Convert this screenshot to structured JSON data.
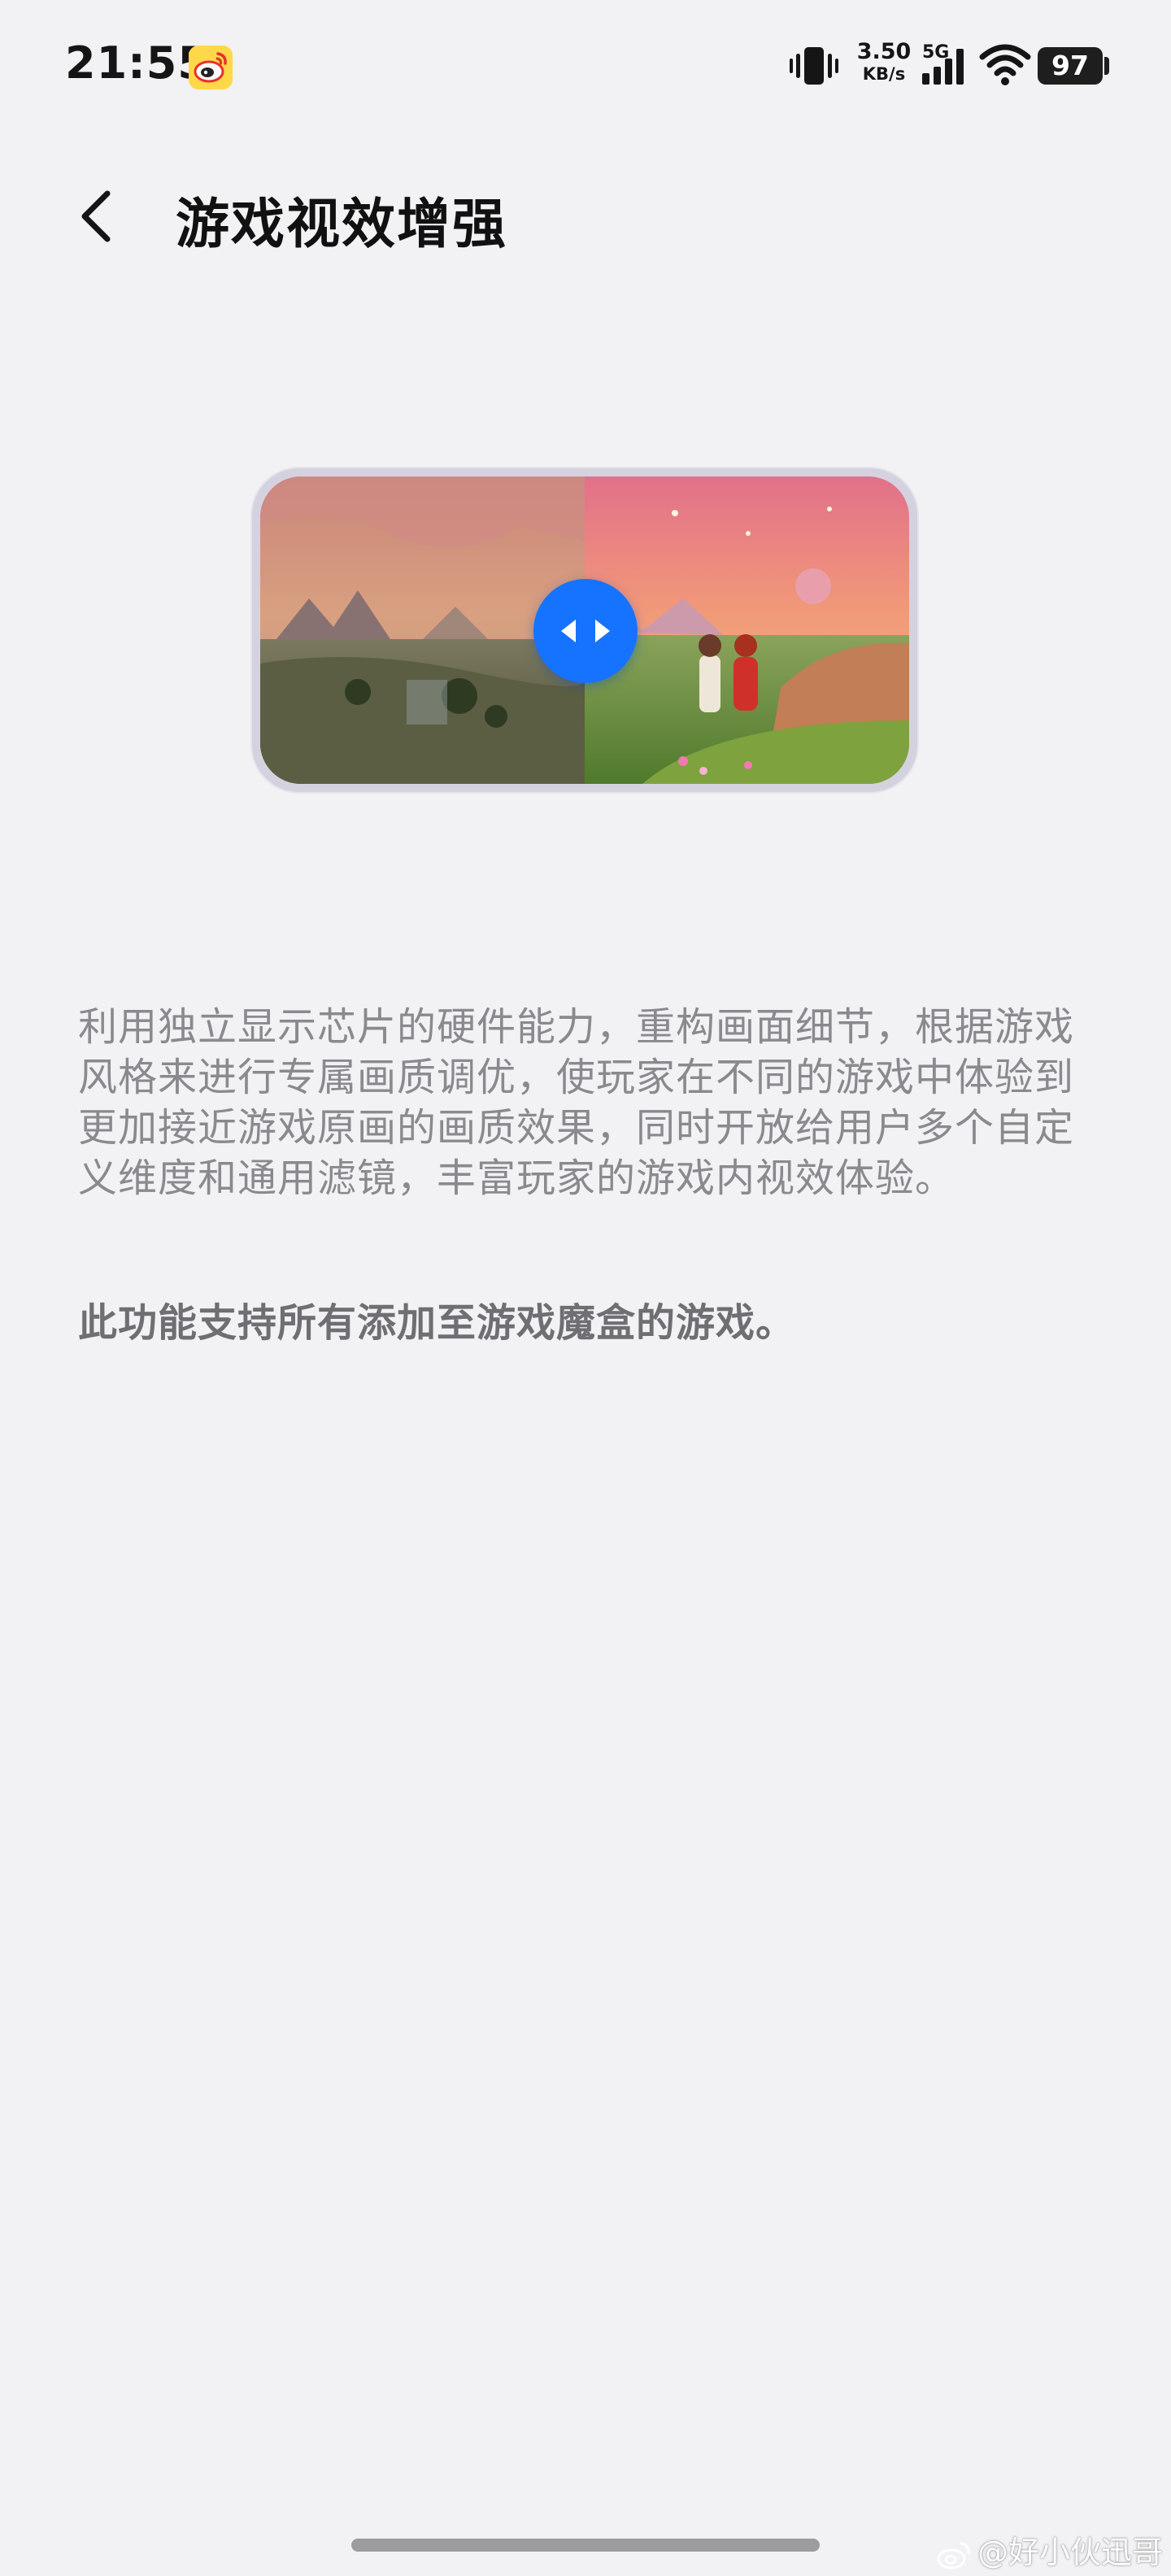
{
  "status_bar": {
    "time": "21:55",
    "net_speed_value": "3.50",
    "net_speed_unit": "KB/s",
    "network_type": "5G",
    "battery": "97",
    "icons": [
      "weibo-icon",
      "vibrate-icon",
      "signal-icon",
      "wifi-icon",
      "battery-icon"
    ]
  },
  "header": {
    "title": "游戏视效增强",
    "back_icon": "chevron-left-icon"
  },
  "preview": {
    "handle_icon": "compare-arrows-icon",
    "accent_color": "#1673ff"
  },
  "content": {
    "description": "利用独立显示芯片的硬件能力，重构画面细节，根据游戏风格来进行专属画质调优，使玩家在不同的游戏中体验到更加接近游戏原画的画质效果，同时开放给用户多个自定义维度和通用滤镜，丰富玩家的游戏内视效体验。",
    "support_note": "此功能支持所有添加至游戏魔盒的游戏。"
  },
  "watermark": {
    "text": "@好小伙迅哥"
  }
}
